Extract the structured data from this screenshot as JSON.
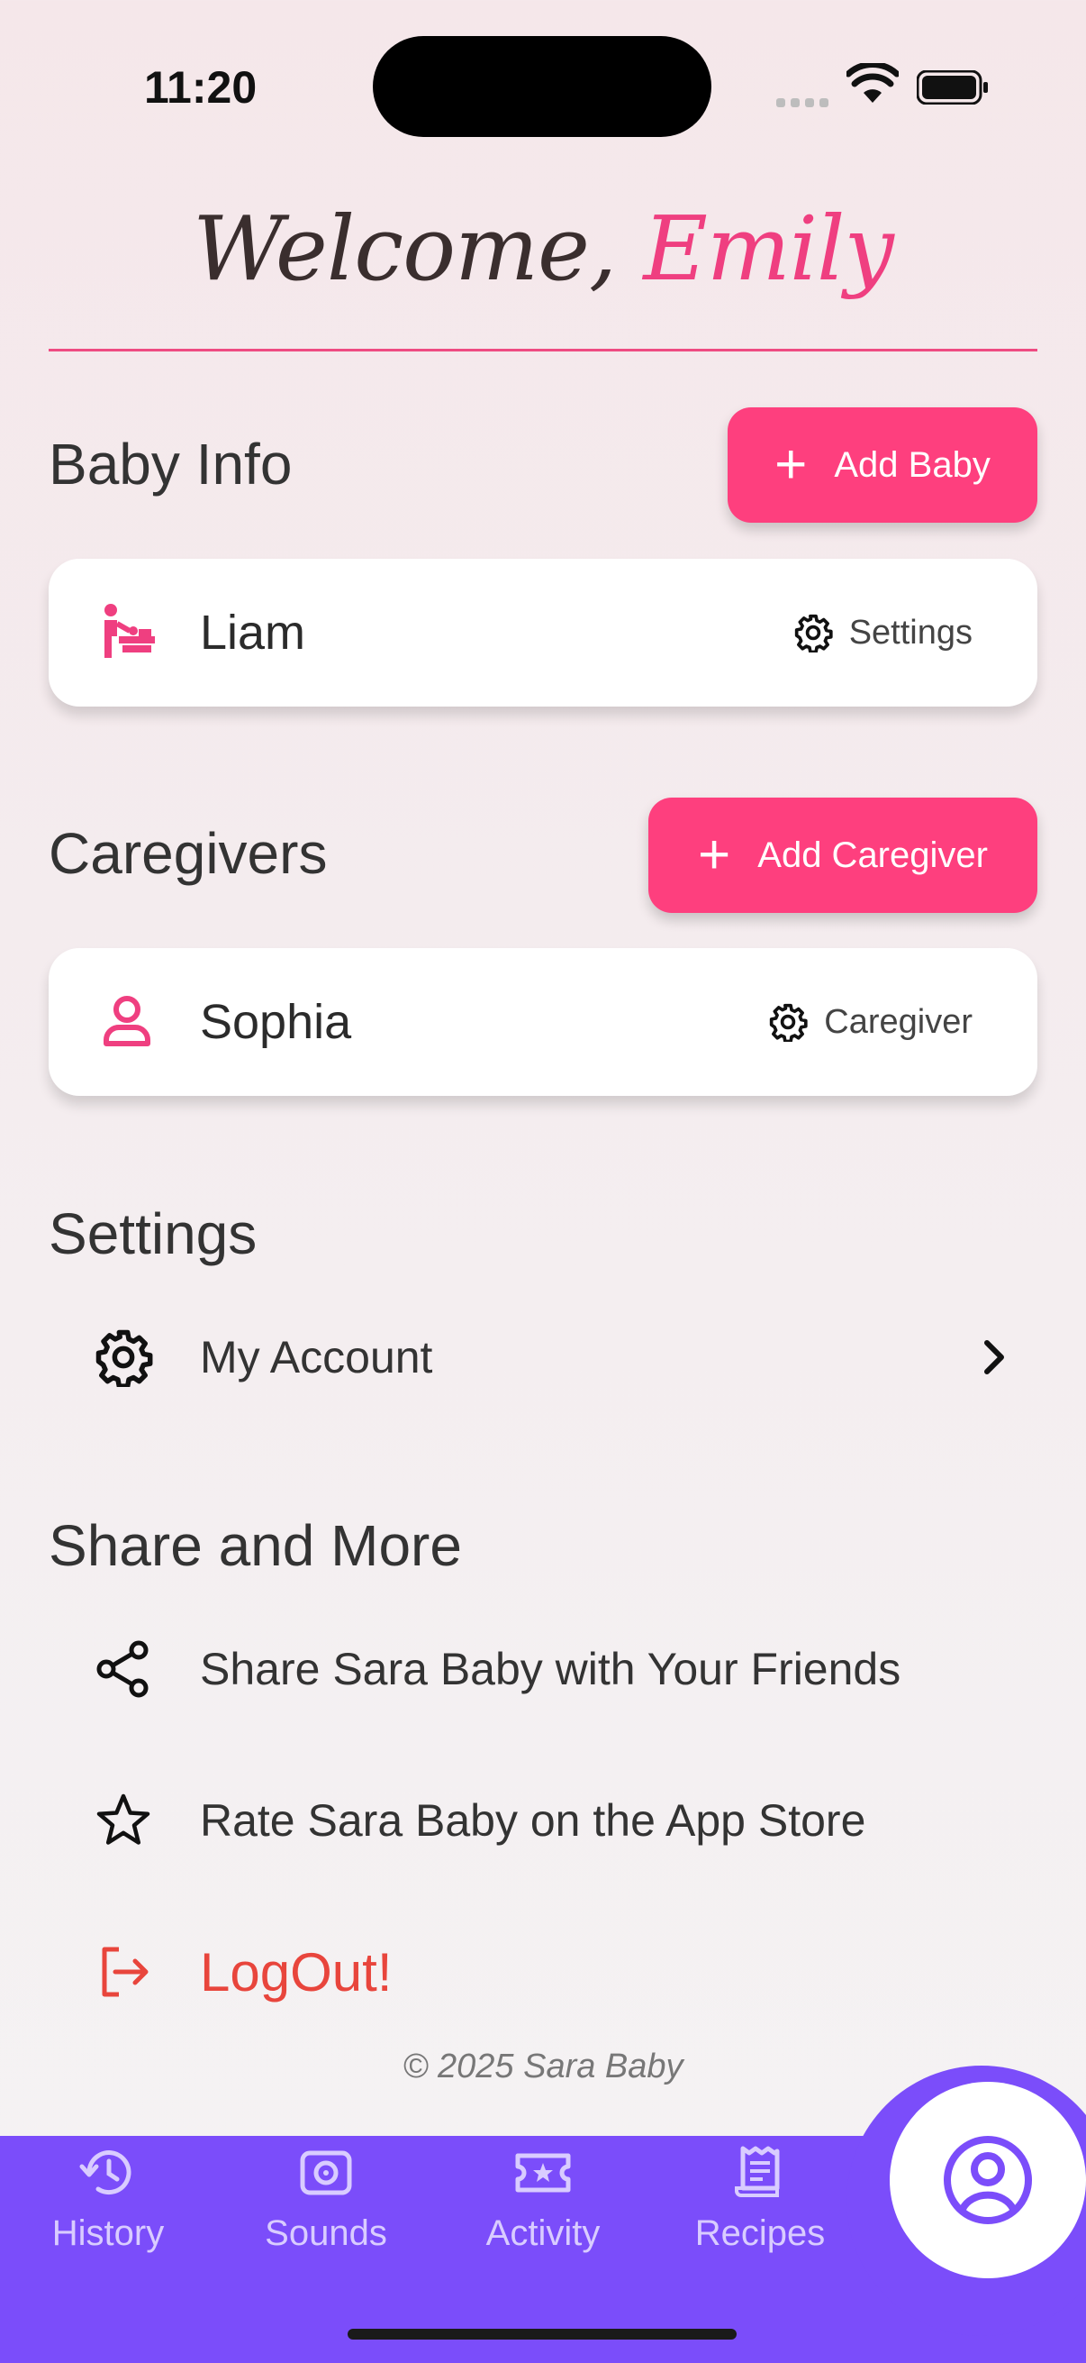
{
  "status_bar": {
    "time": "11:20"
  },
  "welcome": {
    "greeting": "Welcome,",
    "name": "Emily"
  },
  "baby_info": {
    "title": "Baby Info",
    "add_button_label": "Add Baby",
    "baby": {
      "name": "Liam",
      "icon": "baby-changing-icon",
      "action_label": "Settings"
    }
  },
  "caregivers": {
    "title": "Caregivers",
    "add_button_label": "Add Caregiver",
    "caregiver": {
      "name": "Sophia",
      "icon": "person-icon",
      "action_label": "Caregiver"
    }
  },
  "settings": {
    "title": "Settings",
    "items": [
      {
        "label": "My Account",
        "icon": "gear-icon"
      }
    ]
  },
  "share_more": {
    "title": "Share and More",
    "items": [
      {
        "label": "Share Sara Baby with Your Friends",
        "icon": "share-icon"
      },
      {
        "label": "Rate Sara Baby on the App Store",
        "icon": "star-icon"
      },
      {
        "label": "LogOut!",
        "icon": "logout-icon"
      }
    ]
  },
  "footer": {
    "copyright": "© 2025 Sara Baby"
  },
  "bottom_nav": {
    "items": [
      {
        "label": "History",
        "icon": "history-icon"
      },
      {
        "label": "Sounds",
        "icon": "speaker-icon"
      },
      {
        "label": "Activity",
        "icon": "ticket-star-icon"
      },
      {
        "label": "Recipes",
        "icon": "receipt-icon"
      }
    ],
    "active": "profile"
  },
  "colors": {
    "accent": "#fe3f7e",
    "nav": "#7b4dfa",
    "logout": "#e8453c"
  }
}
